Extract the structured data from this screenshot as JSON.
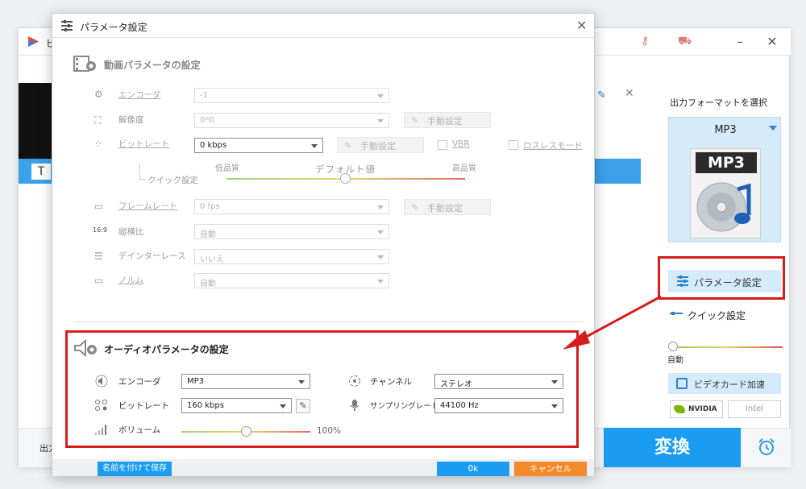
{
  "main_window": {
    "title": "ビ",
    "right_panel": {
      "title": "出力フォーマットを選択",
      "format_name": "MP3",
      "format_icon_label": "MP3",
      "param_button": "パラメータ設定",
      "quick_settings": "クイック設定",
      "quick_auto": "自動",
      "gpu_accel": "ビデオカード加速",
      "nvidia": "NVIDIA",
      "intel": "Intel"
    },
    "t_box": "T",
    "output_label": "出力",
    "convert_button": "変換"
  },
  "dialog": {
    "title": "パラメータ設定",
    "video": {
      "heading": "動画パラメータの設定",
      "encoder": {
        "label": "エンコーダ",
        "value": "-1"
      },
      "resolution": {
        "label": "解像度",
        "value": "0*0",
        "manual": "手動設定"
      },
      "bitrate": {
        "label": "ビットレート",
        "value": "0 kbps",
        "manual": "手動設定",
        "vbr": "VBR",
        "lossless": "ロスレスモード"
      },
      "quick": {
        "label": "クイック設定",
        "low": "低品質",
        "default": "デフォルト値",
        "high": "高品質"
      },
      "framerate": {
        "label": "フレームレート",
        "value": "0 fps",
        "manual": "手動設定"
      },
      "aspect": {
        "label": "縦横比",
        "value": "自動",
        "icon_text": "16:9"
      },
      "deinterlace": {
        "label": "デインターレース",
        "value": "いいえ"
      },
      "norm": {
        "label": "ノルム",
        "value": "自動"
      }
    },
    "audio": {
      "heading": "オーディオパラメータの設定",
      "encoder": {
        "label": "エンコーダ",
        "value": "MP3"
      },
      "bitrate": {
        "label": "ビットレート",
        "value": "160 kbps"
      },
      "volume": {
        "label": "ボリューム",
        "value": "100%",
        "level_percent": 100
      },
      "channel": {
        "label": "チャンネル",
        "value": "ステレオ"
      },
      "sampling": {
        "label": "サンプリングレート",
        "value": "44100 Hz"
      }
    },
    "footer": {
      "save_as": "名前を付けて保存",
      "ok": "0k",
      "cancel": "キャンセル"
    }
  },
  "colors": {
    "accent_blue": "#1a9df0",
    "cancel_orange": "#f48a2a",
    "annotation_red": "#d61d1d",
    "format_card_bg": "#d6ebfa"
  }
}
